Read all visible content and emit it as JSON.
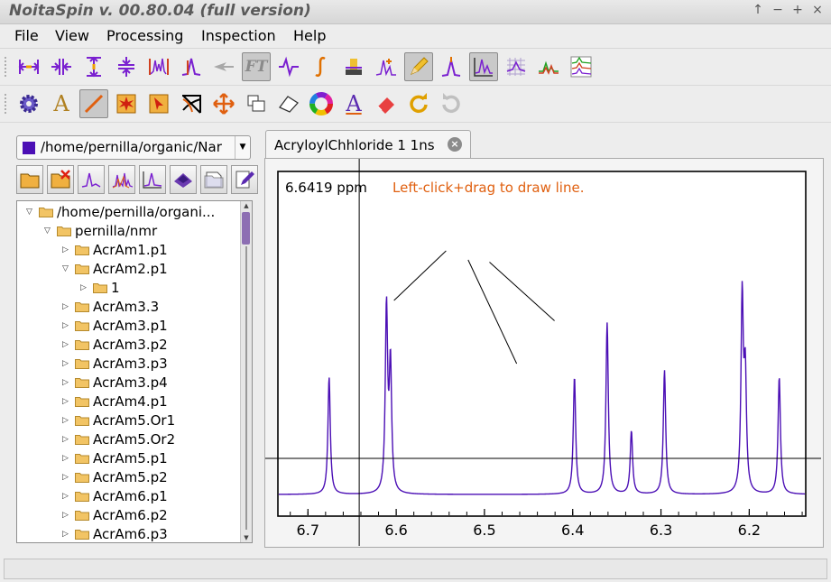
{
  "window": {
    "title": "NoitaSpin v. 00.80.04 (full version)",
    "buttons": [
      "↑",
      "−",
      "+",
      "×"
    ]
  },
  "menu": [
    "File",
    "View",
    "Processing",
    "Inspection",
    "Help"
  ],
  "toolbar1": [
    {
      "icon": "horizontal-expand-icon"
    },
    {
      "icon": "horizontal-compress-icon"
    },
    {
      "icon": "vertical-expand-icon"
    },
    {
      "icon": "vertical-compress-icon"
    },
    {
      "icon": "zoom-spectrum-icon"
    },
    {
      "icon": "peak-zoom-icon"
    },
    {
      "icon": "arrow-pointer-icon"
    },
    {
      "icon": "fourier-transform-icon",
      "text": "FT"
    },
    {
      "icon": "phase-icon"
    },
    {
      "icon": "integral-icon"
    },
    {
      "icon": "baseline-stamp-icon"
    },
    {
      "icon": "peak-pick-icon"
    },
    {
      "icon": "pencil-icon"
    },
    {
      "icon": "peak-label-icon"
    },
    {
      "icon": "spectrum-view-icon"
    },
    {
      "icon": "grid-spectrum-icon"
    },
    {
      "icon": "overlay-spectrum-icon"
    },
    {
      "icon": "stacked-spectra-icon"
    }
  ],
  "toolbar2": [
    {
      "icon": "gear-icon"
    },
    {
      "icon": "text-tool-icon",
      "text": "A"
    },
    {
      "icon": "line-tool-icon"
    },
    {
      "icon": "starburst-icon"
    },
    {
      "icon": "select-arrow-icon"
    },
    {
      "icon": "cross-cut-icon"
    },
    {
      "icon": "move-arrows-icon"
    },
    {
      "icon": "rectangle-tool-icon"
    },
    {
      "icon": "polygon-tool-icon"
    },
    {
      "icon": "color-wheel-icon"
    },
    {
      "icon": "font-style-icon",
      "text": "A"
    },
    {
      "icon": "eraser-icon"
    },
    {
      "icon": "redo-icon"
    },
    {
      "icon": "refresh-icon"
    }
  ],
  "panel": {
    "path": "/home/pernilla/organic/Nar",
    "tools": [
      {
        "icon": "open-folder-icon"
      },
      {
        "icon": "close-folder-icon"
      },
      {
        "icon": "spectrum-file-icon"
      },
      {
        "icon": "multi-spectrum-icon"
      },
      {
        "icon": "spectrum-1d-icon"
      },
      {
        "icon": "spectrum-3d-icon"
      },
      {
        "icon": "new-file-icon"
      },
      {
        "icon": "edit-file-icon"
      }
    ],
    "tree": [
      {
        "label": "/home/pernilla/organi...",
        "depth": 0,
        "expand": "▽"
      },
      {
        "label": "pernilla/nmr",
        "depth": 1,
        "expand": "▽"
      },
      {
        "label": "AcrAm1.p1",
        "depth": 2,
        "expand": "▷"
      },
      {
        "label": "AcrAm2.p1",
        "depth": 2,
        "expand": "▽"
      },
      {
        "label": "1",
        "depth": 3,
        "expand": "▷"
      },
      {
        "label": "AcrAm3.3",
        "depth": 2,
        "expand": "▷"
      },
      {
        "label": "AcrAm3.p1",
        "depth": 2,
        "expand": "▷"
      },
      {
        "label": "AcrAm3.p2",
        "depth": 2,
        "expand": "▷"
      },
      {
        "label": "AcrAm3.p3",
        "depth": 2,
        "expand": "▷"
      },
      {
        "label": "AcrAm3.p4",
        "depth": 2,
        "expand": "▷"
      },
      {
        "label": "AcrAm4.p1",
        "depth": 2,
        "expand": "▷"
      },
      {
        "label": "AcrAm5.Or1",
        "depth": 2,
        "expand": "▷"
      },
      {
        "label": "AcrAm5.Or2",
        "depth": 2,
        "expand": "▷"
      },
      {
        "label": "AcrAm5.p1",
        "depth": 2,
        "expand": "▷"
      },
      {
        "label": "AcrAm5.p2",
        "depth": 2,
        "expand": "▷"
      },
      {
        "label": "AcrAm6.p1",
        "depth": 2,
        "expand": "▷"
      },
      {
        "label": "AcrAm6.p2",
        "depth": 2,
        "expand": "▷"
      },
      {
        "label": "AcrAm6.p3",
        "depth": 2,
        "expand": "▷"
      }
    ]
  },
  "tab": {
    "label": "AcryloylChhloride 1 1ns",
    "close": "×"
  },
  "spectrum": {
    "cursor_readout": "6.6419 ppm",
    "hint": "Left-click+drag to draw line.",
    "colors": {
      "spectrum": "#4b0fb5",
      "hint": "#e06010",
      "cursor": "#000000",
      "annotation": "#000000"
    }
  },
  "chart_data": {
    "type": "line",
    "xlabel": "",
    "ylabel": "",
    "x_unit": "ppm",
    "xlim": [
      6.733,
      6.137
    ],
    "x_reversed": true,
    "x_ticks": [
      "6.7",
      "6.6",
      "6.5",
      "6.4",
      "6.3",
      "6.2"
    ],
    "cursor_x": 6.6419,
    "baseline_y": 0.0,
    "series": [
      {
        "peaks": [
          {
            "x": 6.676,
            "height": 0.52
          },
          {
            "x": 6.611,
            "height": 0.82
          },
          {
            "x": 6.6065,
            "height": 0.56
          },
          {
            "x": 6.398,
            "height": 0.52
          },
          {
            "x": 6.361,
            "height": 0.76
          },
          {
            "x": 6.3335,
            "height": 0.28
          },
          {
            "x": 6.296,
            "height": 0.55
          },
          {
            "x": 6.208,
            "height": 0.86
          },
          {
            "x": 6.2045,
            "height": 0.5
          },
          {
            "x": 6.166,
            "height": 0.52
          }
        ],
        "peak_width_ppm": 0.0016
      }
    ],
    "annotation_lines": [
      {
        "x1": 6.6025,
        "y1": 0.86,
        "x2": 6.5435,
        "y2": 1.08
      },
      {
        "x1": 6.5185,
        "y1": 1.04,
        "x2": 6.4635,
        "y2": 0.58
      },
      {
        "x1": 6.4943,
        "y1": 1.03,
        "x2": 6.4206,
        "y2": 0.77
      }
    ],
    "hline_y": 0.16
  }
}
